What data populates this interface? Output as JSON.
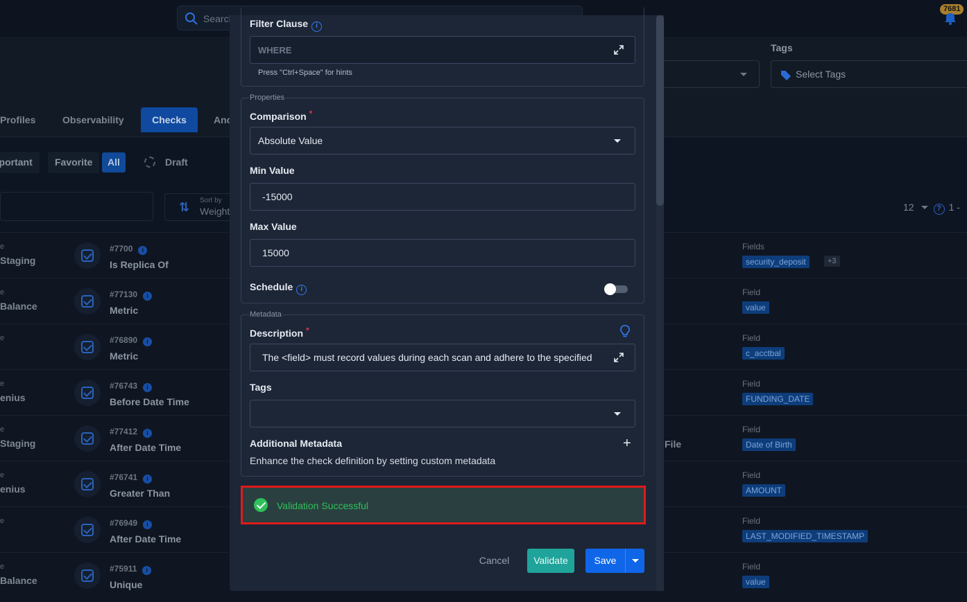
{
  "topbar": {
    "search_placeholder": "Search",
    "notification_count": "7681"
  },
  "filters": {
    "tags_label": "Tags",
    "tags_placeholder": "Select Tags"
  },
  "tabs": [
    "Profiles",
    "Observability",
    "Checks",
    "Anc"
  ],
  "active_tab": "Checks",
  "chips": [
    "nportant",
    "Favorite",
    "All"
  ],
  "draft_label": "Draft",
  "sort": {
    "small": "Sort by",
    "value": "Weight"
  },
  "pager": {
    "per_page": "12",
    "range": "1 -"
  },
  "rows": [
    {
      "left_small": "e",
      "left_big": "Staging",
      "num": "#7700",
      "type": "Is Replica Of",
      "field_label": "Fields",
      "field": "security_deposit",
      "more": "+3"
    },
    {
      "left_small": "e",
      "left_big": "Balance",
      "num": "#77130",
      "type": "Metric",
      "field_label": "Field",
      "field": "value"
    },
    {
      "left_small": "e",
      "left_big": "",
      "num": "#76890",
      "type": "Metric",
      "field_label": "Field",
      "field": "c_acctbal"
    },
    {
      "left_small": "e",
      "left_big": "enius",
      "num": "#76743",
      "type": "Before Date Time",
      "field_label": "Field",
      "field": "FUNDING_DATE"
    },
    {
      "left_small": "e",
      "left_big": " Staging",
      "num": "#77412",
      "type": "After Date Time",
      "field_label": "Field",
      "field": "Date of Birth"
    },
    {
      "left_small": "e",
      "left_big": "enius",
      "num": "#76741",
      "type": "Greater Than",
      "field_label": "Field",
      "field": "AMOUNT"
    },
    {
      "left_small": "e",
      "left_big": "",
      "num": "#76949",
      "type": "After Date Time",
      "field_label": "Field",
      "field": "LAST_MODIFIED_TIMESTAMP"
    },
    {
      "left_small": "e",
      "left_big": "Balance",
      "num": "#75911",
      "type": "Unique",
      "field_label": "Field",
      "field": "value"
    }
  ],
  "file_text": "File",
  "modal": {
    "filter_clause_label": "Filter Clause",
    "filter_clause_placeholder": "WHERE",
    "filter_hint": "Press \"Ctrl+Space\" for hints",
    "properties_legend": "Properties",
    "comparison_label": "Comparison",
    "comparison_value": "Absolute Value",
    "min_label": "Min Value",
    "min_value": "-15000",
    "max_label": "Max Value",
    "max_value": "15000",
    "schedule_label": "Schedule",
    "schedule_enabled": false,
    "metadata_legend": "Metadata",
    "description_label": "Description",
    "description_value": "The <field> must record values during each scan and adhere to the specified",
    "tags_label": "Tags",
    "additional_metadata_label": "Additional Metadata",
    "additional_metadata_desc": "Enhance the check definition by setting custom metadata",
    "validation_message": "Validation Successful",
    "cancel_label": "Cancel",
    "validate_label": "Validate",
    "save_label": "Save"
  },
  "colors": {
    "primary": "#0f66e8",
    "validate": "#1fa39a",
    "success": "#2fc05c",
    "highlight_border": "#e21a1a",
    "required": "#e0364a"
  }
}
